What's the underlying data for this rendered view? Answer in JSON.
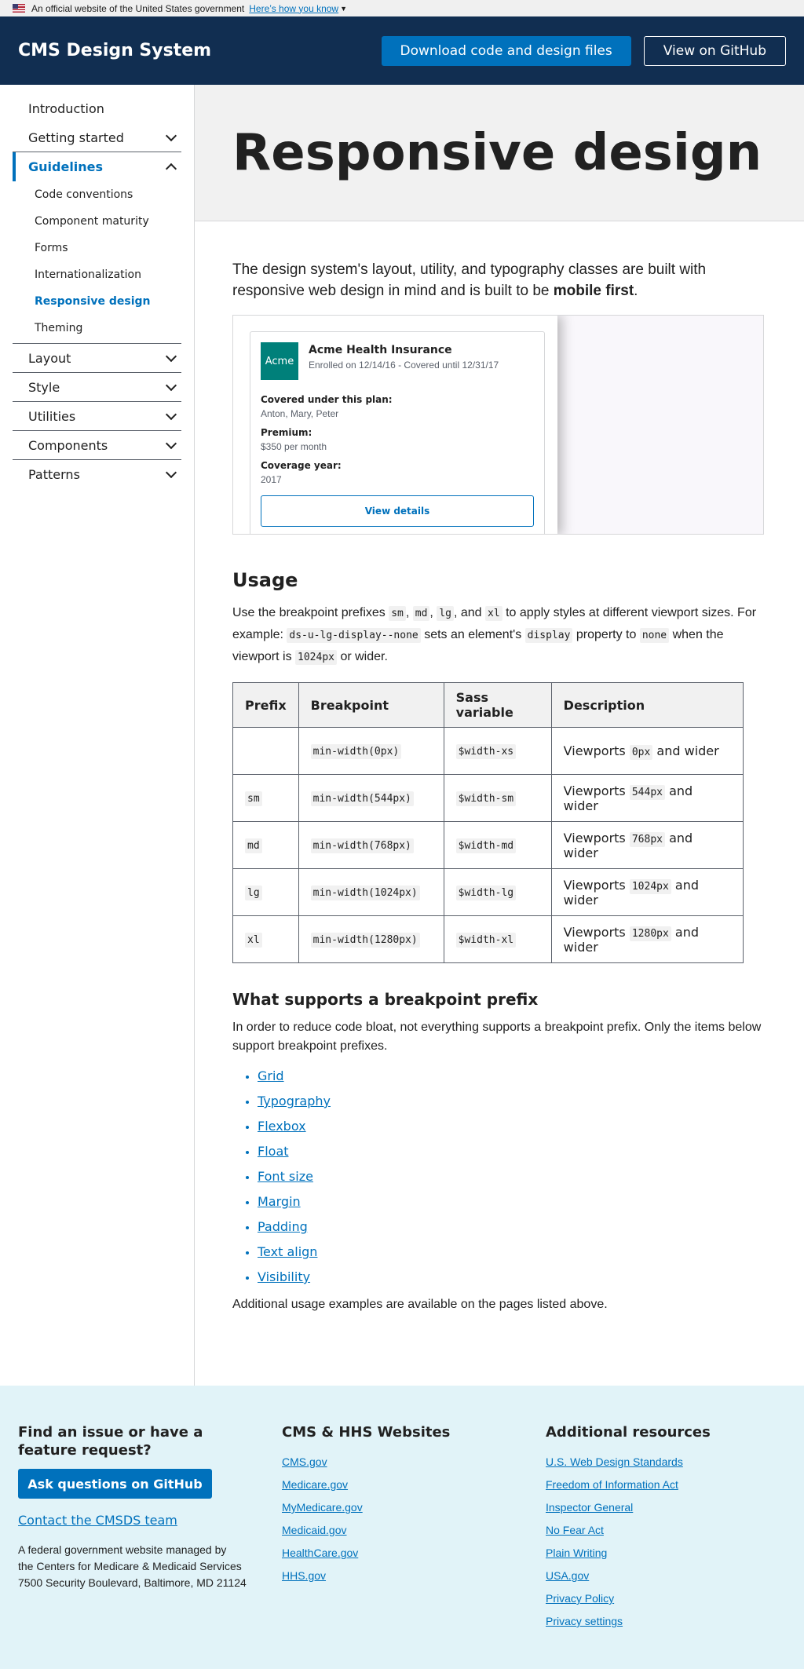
{
  "gov_banner": {
    "text": "An official website of the United States government",
    "link": "Here’s how you know"
  },
  "header": {
    "brand": "CMS Design System",
    "download_label": "Download code and design files",
    "github_label": "View on GitHub"
  },
  "sidebar": {
    "items": [
      {
        "label": "Introduction"
      },
      {
        "label": "Getting started"
      },
      {
        "label": "Guidelines"
      },
      {
        "label": "Layout"
      },
      {
        "label": "Style"
      },
      {
        "label": "Utilities"
      },
      {
        "label": "Components"
      },
      {
        "label": "Patterns"
      }
    ],
    "guidelines_children": [
      {
        "label": "Code conventions"
      },
      {
        "label": "Component maturity"
      },
      {
        "label": "Forms"
      },
      {
        "label": "Internationalization"
      },
      {
        "label": "Responsive design"
      },
      {
        "label": "Theming"
      }
    ]
  },
  "page": {
    "title": "Responsive design",
    "intro_text": "The design system's layout, utility, and typography classes are built with responsive web design in mind and is built to be ",
    "intro_bold": "mobile first",
    "intro_end": "."
  },
  "example_card": {
    "logo": "Acme",
    "name": "Acme Health Insurance",
    "enrolled": "Enrolled on 12/14/16 - Covered until 12/31/17",
    "fields": [
      {
        "label": "Covered under this plan:",
        "value": "Anton, Mary, Peter"
      },
      {
        "label": "Premium:",
        "value": "$350 per month"
      },
      {
        "label": "Coverage year:",
        "value": "2017"
      }
    ],
    "button": "View details"
  },
  "usage": {
    "heading": "Usage",
    "p1": "Use the breakpoint prefixes ",
    "sm": "sm",
    "md": "md",
    "lg": "lg",
    "xl": "xl",
    "comma": ", ",
    "and": ", and ",
    "p2": " to apply styles at different viewport sizes. For example: ",
    "class_example": "ds-u-lg-display--none",
    "p3": " sets an element's ",
    "display": "display",
    "p4": " property to ",
    "none": "none",
    "p5": " when the viewport is ",
    "px1024": "1024px",
    "p6": " or wider."
  },
  "table": {
    "headers": [
      "Prefix",
      "Breakpoint",
      "Sass variable",
      "Description"
    ],
    "rows": [
      {
        "prefix": "",
        "breakpoint": "min-width(0px)",
        "sass": "$width-xs",
        "desc_pre": "Viewports ",
        "desc_code": "0px",
        "desc_post": " and wider"
      },
      {
        "prefix": "sm",
        "breakpoint": "min-width(544px)",
        "sass": "$width-sm",
        "desc_pre": "Viewports ",
        "desc_code": "544px",
        "desc_post": " and wider"
      },
      {
        "prefix": "md",
        "breakpoint": "min-width(768px)",
        "sass": "$width-md",
        "desc_pre": "Viewports ",
        "desc_code": "768px",
        "desc_post": " and wider"
      },
      {
        "prefix": "lg",
        "breakpoint": "min-width(1024px)",
        "sass": "$width-lg",
        "desc_pre": "Viewports ",
        "desc_code": "1024px",
        "desc_post": " and wider"
      },
      {
        "prefix": "xl",
        "breakpoint": "min-width(1280px)",
        "sass": "$width-xl",
        "desc_pre": "Viewports ",
        "desc_code": "1280px",
        "desc_post": " and wider"
      }
    ]
  },
  "supports": {
    "heading": "What supports a breakpoint prefix",
    "text": "In order to reduce code bloat, not everything supports a breakpoint prefix. Only the items below support breakpoint prefixes.",
    "links": [
      "Grid",
      "Typography",
      "Flexbox",
      "Float",
      "Font size",
      "Margin",
      "Padding",
      "Text align",
      "Visibility"
    ],
    "additional": "Additional usage examples are available on the pages listed above."
  },
  "footer": {
    "issue_heading": "Find an issue or have a feature request?",
    "ask_button": "Ask questions on GitHub",
    "contact": "Contact the CMSDS team",
    "address_line1": "A federal government website managed by",
    "address_line2": "the Centers for Medicare & Medicaid Services",
    "address_line3": "7500 Security Boulevard, Baltimore, MD 21124",
    "websites_heading": "CMS & HHS Websites",
    "websites": [
      "CMS.gov",
      "Medicare.gov",
      "MyMedicare.gov",
      "Medicaid.gov",
      "HealthCare.gov",
      "HHS.gov"
    ],
    "resources_heading": "Additional resources",
    "resources": [
      "U.S. Web Design Standards",
      "Freedom of Information Act",
      "Inspector General",
      "No Fear Act",
      "Plain Writing",
      "USA.gov",
      "Privacy Policy",
      "Privacy settings"
    ]
  },
  "colors": {
    "header_bg": "#112e51",
    "primary": "#0071bc",
    "footer_bg": "#e1f3f8",
    "acme_logo": "#00807a"
  }
}
